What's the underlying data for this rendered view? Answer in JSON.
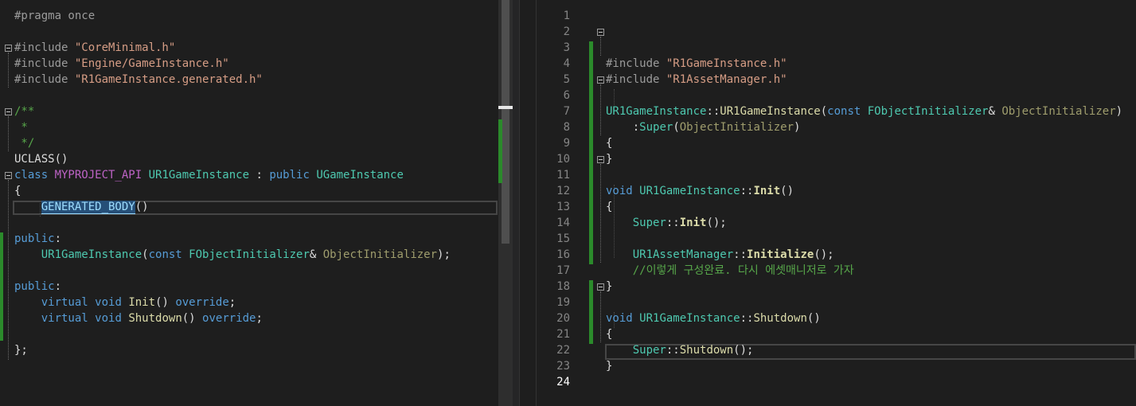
{
  "left_editor": {
    "lines": [
      [
        {
          "t": "#pragma once",
          "c": "t-pre"
        }
      ],
      [],
      [
        {
          "t": "#include ",
          "c": "t-pre"
        },
        {
          "t": "\"CoreMinimal.h\"",
          "c": "t-str"
        }
      ],
      [
        {
          "t": "#include ",
          "c": "t-pre"
        },
        {
          "t": "\"Engine/GameInstance.h\"",
          "c": "t-str"
        }
      ],
      [
        {
          "t": "#include ",
          "c": "t-pre"
        },
        {
          "t": "\"R1GameInstance.generated.h\"",
          "c": "t-str"
        }
      ],
      [],
      [
        {
          "t": "/**",
          "c": "t-cmt"
        }
      ],
      [
        {
          "t": " *",
          "c": "t-cmt"
        }
      ],
      [
        {
          "t": " */",
          "c": "t-cmt"
        }
      ],
      [
        {
          "t": "UCLASS",
          "c": "t-plain"
        },
        {
          "t": "()",
          "c": "t-plain"
        }
      ],
      [
        {
          "t": "class ",
          "c": "t-kw"
        },
        {
          "t": "MYPROJECT_API ",
          "c": "t-macro"
        },
        {
          "t": "UR1GameInstance",
          "c": "t-type"
        },
        {
          "t": " : ",
          "c": "t-plain"
        },
        {
          "t": "public ",
          "c": "t-kw"
        },
        {
          "t": "UGameInstance",
          "c": "t-type"
        }
      ],
      [
        {
          "t": "{",
          "c": "t-plain"
        }
      ],
      [
        {
          "t": "    ",
          "c": "t-plain"
        },
        {
          "t": "GENERATED_BODY",
          "c": "sel-highlight"
        },
        {
          "t": "()",
          "c": "t-plain"
        }
      ],
      [],
      [
        {
          "t": "public",
          "c": "t-kw"
        },
        {
          "t": ":",
          "c": "t-plain"
        }
      ],
      [
        {
          "t": "    ",
          "c": "t-plain"
        },
        {
          "t": "UR1GameInstance",
          "c": "t-type"
        },
        {
          "t": "(",
          "c": "t-plain"
        },
        {
          "t": "const ",
          "c": "t-kw"
        },
        {
          "t": "FObjectInitializer",
          "c": "t-type"
        },
        {
          "t": "& ",
          "c": "t-plain"
        },
        {
          "t": "ObjectInitializer",
          "c": "t-param"
        },
        {
          "t": ");",
          "c": "t-plain"
        }
      ],
      [],
      [
        {
          "t": "public",
          "c": "t-kw"
        },
        {
          "t": ":",
          "c": "t-plain"
        }
      ],
      [
        {
          "t": "    ",
          "c": "t-plain"
        },
        {
          "t": "virtual ",
          "c": "t-kw"
        },
        {
          "t": "void ",
          "c": "t-kw"
        },
        {
          "t": "Init",
          "c": "t-func"
        },
        {
          "t": "() ",
          "c": "t-plain"
        },
        {
          "t": "override",
          "c": "t-kw"
        },
        {
          "t": ";",
          "c": "t-plain"
        }
      ],
      [
        {
          "t": "    ",
          "c": "t-plain"
        },
        {
          "t": "virtual ",
          "c": "t-kw"
        },
        {
          "t": "void ",
          "c": "t-kw"
        },
        {
          "t": "Shutdown",
          "c": "t-func"
        },
        {
          "t": "() ",
          "c": "t-plain"
        },
        {
          "t": "override",
          "c": "t-kw"
        },
        {
          "t": ";",
          "c": "t-plain"
        }
      ],
      [],
      [
        {
          "t": "};",
          "c": "t-plain"
        }
      ]
    ]
  },
  "right_editor": {
    "line_numbers": [
      "1",
      "2",
      "3",
      "4",
      "5",
      "6",
      "7",
      "8",
      "9",
      "10",
      "11",
      "12",
      "13",
      "14",
      "15",
      "16",
      "17",
      "18",
      "19",
      "20",
      "21",
      "22",
      "23",
      "24"
    ],
    "current_line": "24",
    "lines": [
      [],
      [],
      [],
      [
        {
          "t": "#include ",
          "c": "t-pre"
        },
        {
          "t": "\"R1GameInstance.h\"",
          "c": "t-str"
        }
      ],
      [
        {
          "t": "#include ",
          "c": "t-pre"
        },
        {
          "t": "\"R1AssetManager.h\"",
          "c": "t-str"
        }
      ],
      [],
      [
        {
          "t": "UR1GameInstance",
          "c": "t-type"
        },
        {
          "t": "::",
          "c": "t-plain"
        },
        {
          "t": "UR1GameInstance",
          "c": "t-func"
        },
        {
          "t": "(",
          "c": "t-plain"
        },
        {
          "t": "const ",
          "c": "t-kw"
        },
        {
          "t": "FObjectInitializer",
          "c": "t-type"
        },
        {
          "t": "& ",
          "c": "t-plain"
        },
        {
          "t": "ObjectInitializer",
          "c": "t-param"
        },
        {
          "t": ")",
          "c": "t-plain"
        }
      ],
      [
        {
          "t": "    :",
          "c": "t-plain"
        },
        {
          "t": "Super",
          "c": "t-type"
        },
        {
          "t": "(",
          "c": "t-plain"
        },
        {
          "t": "ObjectInitializer",
          "c": "t-param"
        },
        {
          "t": ")",
          "c": "t-plain"
        }
      ],
      [
        {
          "t": "{",
          "c": "t-plain"
        }
      ],
      [
        {
          "t": "}",
          "c": "t-plain"
        }
      ],
      [],
      [
        {
          "t": "void ",
          "c": "t-kw"
        },
        {
          "t": "UR1GameInstance",
          "c": "t-type"
        },
        {
          "t": "::",
          "c": "t-plain"
        },
        {
          "t": "Init",
          "c": "t-bold"
        },
        {
          "t": "()",
          "c": "t-plain"
        }
      ],
      [
        {
          "t": "{",
          "c": "t-plain"
        }
      ],
      [
        {
          "t": "    ",
          "c": "t-plain"
        },
        {
          "t": "Super",
          "c": "t-type"
        },
        {
          "t": "::",
          "c": "t-plain"
        },
        {
          "t": "Init",
          "c": "t-bold"
        },
        {
          "t": "();",
          "c": "t-plain"
        }
      ],
      [],
      [
        {
          "t": "    ",
          "c": "t-plain"
        },
        {
          "t": "UR1AssetManager",
          "c": "t-type"
        },
        {
          "t": "::",
          "c": "t-plain"
        },
        {
          "t": "Initialize",
          "c": "t-bold"
        },
        {
          "t": "();",
          "c": "t-plain"
        }
      ],
      [
        {
          "t": "    //이렇게 구성완료. 다시 에셋매니저로 가자",
          "c": "t-cmt"
        }
      ],
      [
        {
          "t": "}",
          "c": "t-plain"
        }
      ],
      [],
      [
        {
          "t": "void ",
          "c": "t-kw"
        },
        {
          "t": "UR1GameInstance",
          "c": "t-type"
        },
        {
          "t": "::",
          "c": "t-plain"
        },
        {
          "t": "Shutdown",
          "c": "t-func"
        },
        {
          "t": "()",
          "c": "t-plain"
        }
      ],
      [
        {
          "t": "{",
          "c": "t-plain"
        }
      ],
      [
        {
          "t": "    ",
          "c": "t-plain"
        },
        {
          "t": "Super",
          "c": "t-type"
        },
        {
          "t": "::",
          "c": "t-plain"
        },
        {
          "t": "Shutdown",
          "c": "t-func"
        },
        {
          "t": "();",
          "c": "t-plain"
        }
      ],
      [
        {
          "t": "}",
          "c": "t-plain"
        }
      ],
      []
    ]
  }
}
